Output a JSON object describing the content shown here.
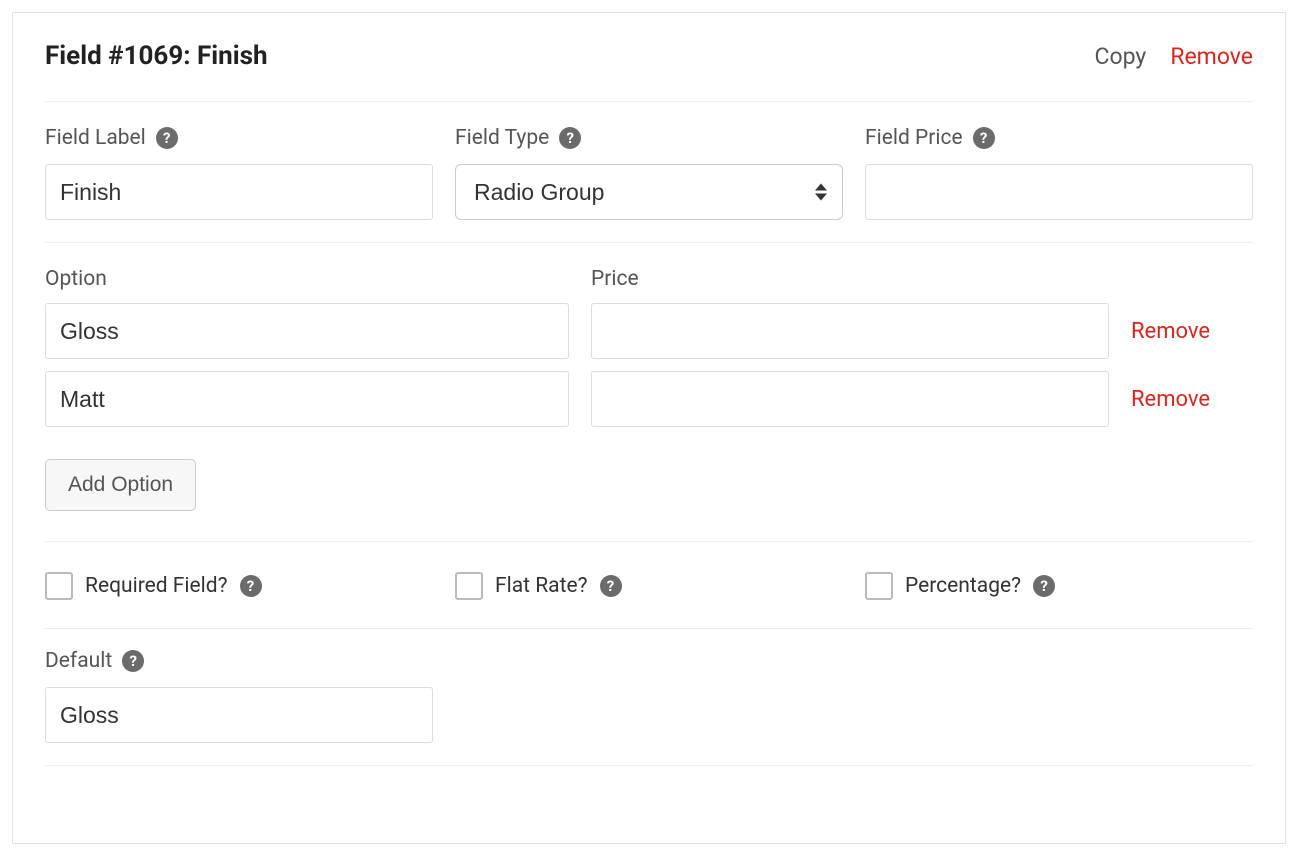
{
  "panel": {
    "title": "Field #1069: Finish",
    "copy_label": "Copy",
    "remove_label": "Remove"
  },
  "labels": {
    "field_label": "Field Label",
    "field_type": "Field Type",
    "field_price": "Field Price",
    "option": "Option",
    "price": "Price",
    "add_option": "Add Option",
    "required": "Required Field?",
    "flat_rate": "Flat Rate?",
    "percentage": "Percentage?",
    "default": "Default",
    "remove": "Remove"
  },
  "values": {
    "field_label": "Finish",
    "field_type": "Radio Group",
    "field_price": "",
    "default": "Gloss"
  },
  "options": [
    {
      "name": "Gloss",
      "price": ""
    },
    {
      "name": "Matt",
      "price": ""
    }
  ],
  "checks": {
    "required": false,
    "flat_rate": false,
    "percentage": false
  }
}
